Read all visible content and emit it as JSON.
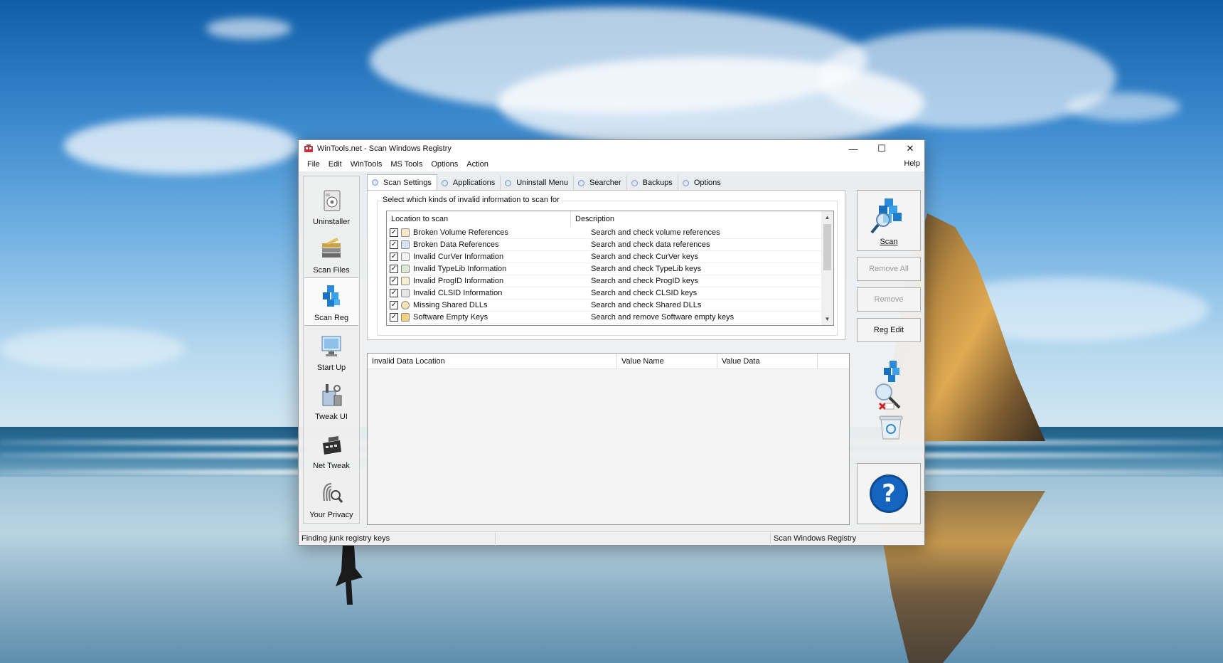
{
  "window": {
    "title": "WinTools.net - Scan Windows Registry",
    "controls": {
      "minimize": "—",
      "maximize": "☐",
      "close": "✕"
    }
  },
  "menu": {
    "items": [
      "File",
      "Edit",
      "WinTools",
      "MS Tools",
      "Options",
      "Action"
    ],
    "help": "Help"
  },
  "sidebar": {
    "items": [
      {
        "label": "Uninstaller",
        "icon": "uninstaller-icon"
      },
      {
        "label": "Scan Files",
        "icon": "scan-files-icon"
      },
      {
        "label": "Scan Reg",
        "icon": "scan-reg-icon",
        "active": true
      },
      {
        "label": "Start Up",
        "icon": "startup-icon"
      },
      {
        "label": "Tweak UI",
        "icon": "tweak-ui-icon"
      },
      {
        "label": "Net Tweak",
        "icon": "net-tweak-icon"
      },
      {
        "label": "Your Privacy",
        "icon": "privacy-icon"
      }
    ]
  },
  "tabs": [
    "Scan Settings",
    "Applications",
    "Uninstall Menu",
    "Searcher",
    "Backups",
    "Options"
  ],
  "scan_settings": {
    "group_label": "Select which kinds of invalid information to scan for",
    "columns": [
      "Location to scan",
      "Description"
    ],
    "rows": [
      {
        "location": "Broken Volume References",
        "description": "Search and check volume references",
        "checked": true
      },
      {
        "location": "Broken Data References",
        "description": "Search and check data references",
        "checked": true
      },
      {
        "location": "Invalid CurVer Information",
        "description": "Search and check CurVer keys",
        "checked": true
      },
      {
        "location": "Invalid TypeLib Information",
        "description": "Search and check TypeLib keys",
        "checked": true
      },
      {
        "location": "Invalid ProgID Information",
        "description": "Search and check ProgID keys",
        "checked": true
      },
      {
        "location": "Invalid CLSID Information",
        "description": "Search and check CLSID keys",
        "checked": true
      },
      {
        "location": "Missing Shared DLLs",
        "description": "Search and check Shared DLLs",
        "checked": true
      },
      {
        "location": "Software Empty Keys",
        "description": "Search and remove Software empty keys",
        "checked": true
      }
    ]
  },
  "results": {
    "columns": [
      "Invalid Data Location",
      "Value Name",
      "Value Data"
    ]
  },
  "actions": {
    "scan": "Scan",
    "remove_all": "Remove All",
    "remove": "Remove",
    "reg_edit": "Reg Edit",
    "help_glyph": "?"
  },
  "status": {
    "left": "Finding junk registry keys",
    "right": "Scan Windows Registry"
  },
  "colors": {
    "accent": "#1a73c9",
    "help_button": "#1565c0",
    "cube": "#1e88d6"
  }
}
